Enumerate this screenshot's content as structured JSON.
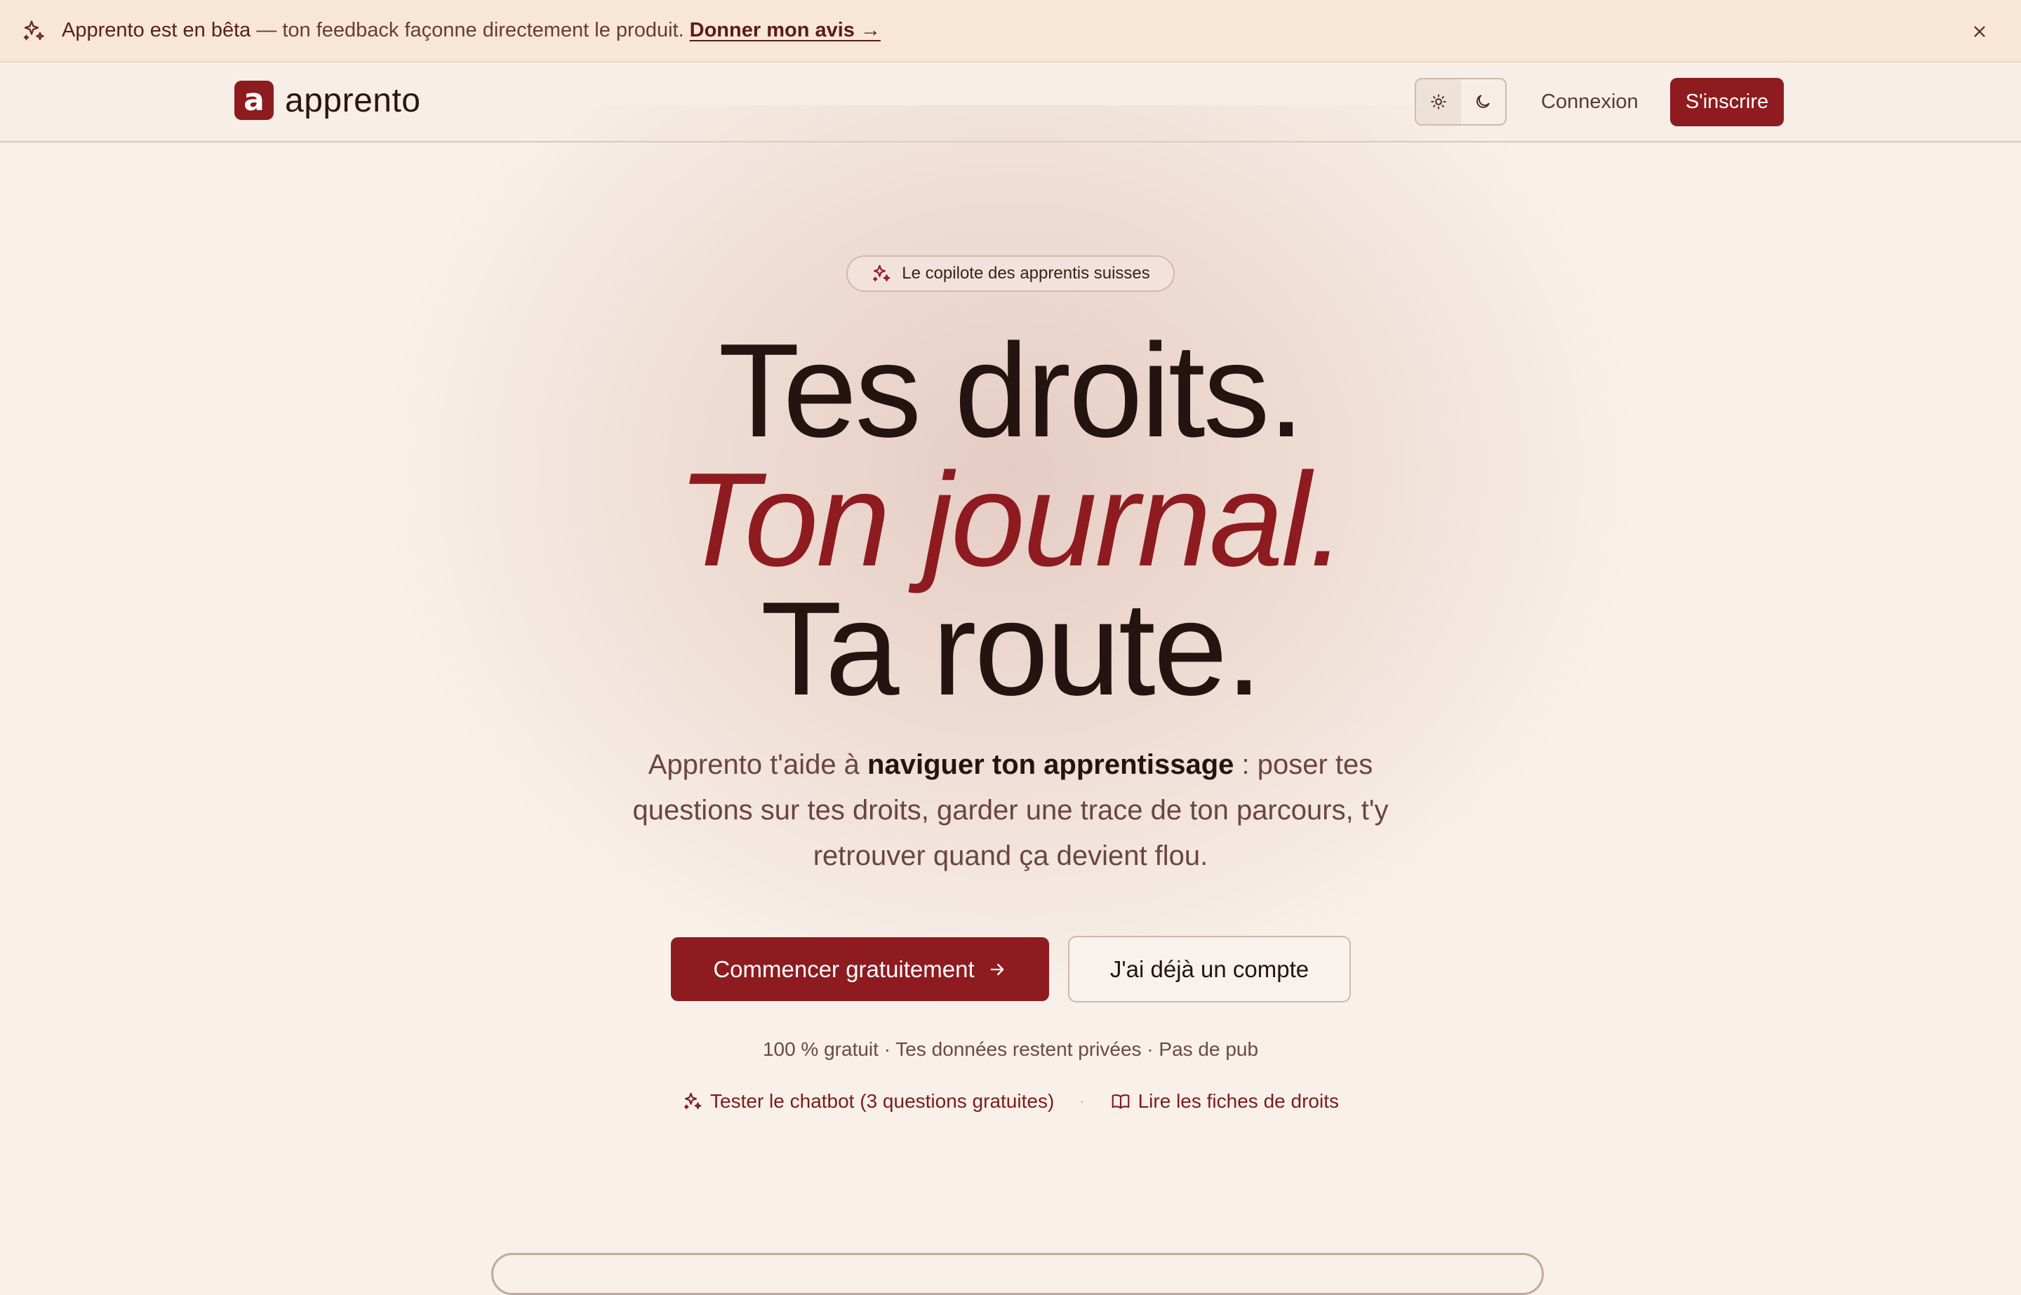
{
  "banner": {
    "strong": "Apprento est en bêta",
    "rest": "— ton feedback façonne directement le produit.",
    "link": "Donner mon avis →",
    "icon": "sparkles-icon",
    "close_icon": "close-icon"
  },
  "header": {
    "logo_mark": "a",
    "logo_text": "apprento",
    "theme_light_icon": "sun-icon",
    "theme_dark_icon": "moon-icon",
    "login": "Connexion",
    "signup": "S'inscrire"
  },
  "hero": {
    "pill": "Le copilote des apprentis suisses",
    "line1": "Tes droits.",
    "line2": "Ton journal.",
    "line3": "Ta route.",
    "lead_before": "Apprento t'aide à ",
    "lead_strong": "naviguer ton apprentissage",
    "lead_after": " : poser tes questions sur tes droits, garder une trace de ton parcours, t'y retrouver quand ça devient flou.",
    "cta_primary": "Commencer gratuitement",
    "cta_secondary": "J'ai déjà un compte",
    "reassure": "100 % gratuit · Tes données restent privées · Pas de pub",
    "link_chatbot": "Tester le chatbot (3 questions gratuites)",
    "link_separator": "·",
    "link_fiches": "Lire les fiches de droits"
  },
  "colors": {
    "accent": "#8e1b1f",
    "background": "#f8f0e9",
    "banner": "#f8e7d4",
    "text": "#231311"
  }
}
